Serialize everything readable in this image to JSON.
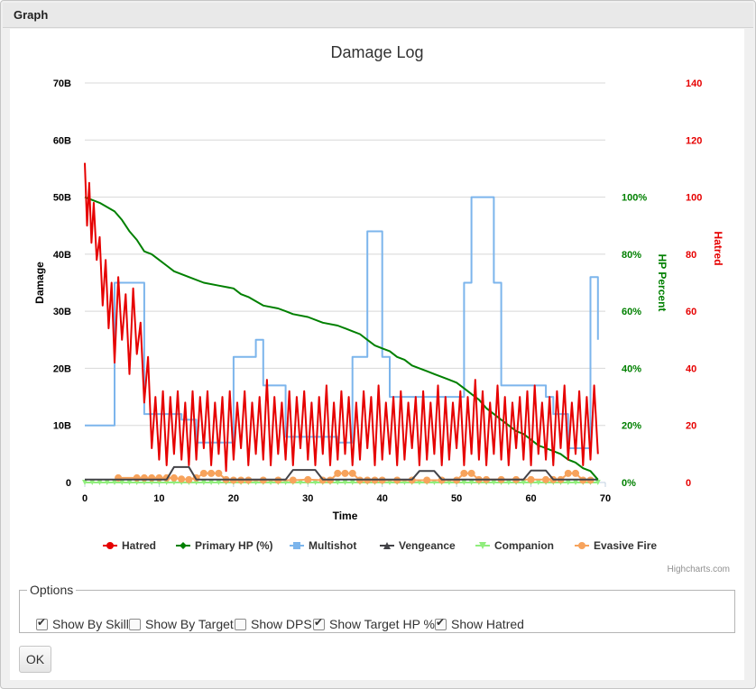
{
  "dialog": {
    "title": "Graph"
  },
  "options": {
    "legend": "Options",
    "items": [
      {
        "label": "Show By Skill",
        "checked": true
      },
      {
        "label": "Show By Target",
        "checked": false
      },
      {
        "label": "Show DPS",
        "checked": false
      },
      {
        "label": "Show Target HP %",
        "checked": true
      },
      {
        "label": "Show Hatred",
        "checked": true
      }
    ]
  },
  "ok_label": "OK",
  "credits": "Highcharts.com",
  "chart_data": {
    "type": "line",
    "title": "Damage Log",
    "xlabel": "Time",
    "xlim": [
      0,
      70
    ],
    "xticks": [
      "0",
      "10",
      "20",
      "30",
      "40",
      "50",
      "60",
      "70"
    ],
    "axes": {
      "damage": {
        "label": "Damage",
        "ylim": [
          0,
          70
        ],
        "ticks": [
          "0",
          "10B",
          "20B",
          "30B",
          "40B",
          "50B",
          "60B",
          "70B"
        ]
      },
      "hp": {
        "label": "HP Percent",
        "ylim": [
          0,
          140
        ],
        "ticks": [
          "0%",
          "20%",
          "40%",
          "60%",
          "80%",
          "100%"
        ],
        "color": "#008000"
      },
      "hatred": {
        "label": "Hatred",
        "ylim": [
          0,
          140
        ],
        "ticks": [
          "0",
          "20",
          "40",
          "60",
          "80",
          "100",
          "120",
          "140"
        ],
        "color": "#e60000"
      }
    },
    "grid": true,
    "legend_position": "bottom",
    "series": [
      {
        "name": "Hatred",
        "color": "#e60000",
        "axis": "hatred",
        "marker": "circle",
        "x": [
          0,
          0.3,
          0.6,
          0.9,
          1.2,
          1.6,
          2,
          2.4,
          2.8,
          3.2,
          3.6,
          4,
          4.5,
          5,
          5.5,
          6,
          6.5,
          7,
          7.5,
          8,
          8.5,
          9,
          9.5,
          10,
          10.5,
          11,
          11.5,
          12,
          12.5,
          13,
          13.5,
          14,
          14.5,
          15,
          15.5,
          16,
          16.5,
          17,
          17.5,
          18,
          18.5,
          19,
          19.5,
          20,
          20.5,
          21,
          21.5,
          22,
          22.5,
          23,
          23.5,
          24,
          24.5,
          25,
          25.5,
          26,
          26.5,
          27,
          27.5,
          28,
          28.5,
          29,
          29.5,
          30,
          30.5,
          31,
          31.5,
          32,
          32.5,
          33,
          33.5,
          34,
          34.5,
          35,
          35.5,
          36,
          36.5,
          37,
          37.5,
          38,
          38.5,
          39,
          39.5,
          40,
          40.5,
          41,
          41.5,
          42,
          42.5,
          43,
          43.5,
          44,
          44.5,
          45,
          45.5,
          46,
          46.5,
          47,
          47.5,
          48,
          48.5,
          49,
          49.5,
          50,
          50.5,
          51,
          51.5,
          52,
          52.5,
          53,
          53.5,
          54,
          54.5,
          55,
          55.5,
          56,
          56.5,
          57,
          57.5,
          58,
          58.5,
          59,
          59.5,
          60,
          60.5,
          61,
          61.5,
          62,
          62.5,
          63,
          63.5,
          64,
          64.5,
          65,
          65.5,
          66,
          66.5,
          67,
          67.5,
          68,
          68.5,
          69
        ],
        "y": [
          112,
          90,
          105,
          84,
          98,
          78,
          86,
          62,
          78,
          54,
          70,
          42,
          72,
          50,
          66,
          38,
          68,
          45,
          56,
          28,
          44,
          12,
          30,
          8,
          32,
          6,
          30,
          10,
          32,
          8,
          28,
          6,
          32,
          8,
          30,
          12,
          32,
          6,
          28,
          10,
          30,
          4,
          32,
          8,
          28,
          12,
          32,
          6,
          28,
          10,
          30,
          8,
          36,
          6,
          30,
          10,
          28,
          8,
          32,
          6,
          30,
          12,
          32,
          8,
          28,
          6,
          30,
          10,
          34,
          6,
          28,
          8,
          32,
          10,
          30,
          6,
          28,
          8,
          32,
          12,
          30,
          6,
          34,
          8,
          28,
          10,
          30,
          6,
          32,
          8,
          28,
          12,
          30,
          6,
          32,
          8,
          28,
          10,
          34,
          6,
          30,
          8,
          28,
          12,
          32,
          6,
          30,
          10,
          36,
          8,
          32,
          6,
          28,
          10,
          34,
          8,
          30,
          6,
          28,
          12,
          30,
          8,
          32,
          6,
          34,
          10,
          28,
          8,
          30,
          6,
          32,
          12,
          34,
          8,
          28,
          10,
          32,
          6,
          30,
          8,
          34,
          10
        ]
      },
      {
        "name": "Primary HP (%)",
        "color": "#008000",
        "axis": "hp",
        "marker": "diamond",
        "x": [
          0,
          2,
          4,
          5,
          6,
          7,
          8,
          9,
          10,
          11,
          12,
          14,
          16,
          18,
          20,
          21,
          22,
          24,
          26,
          27,
          28,
          30,
          32,
          34,
          35,
          36,
          37,
          38,
          39,
          40,
          41,
          42,
          43,
          44,
          45,
          46,
          47,
          48,
          49,
          50,
          51,
          52,
          53,
          54,
          55,
          56,
          57,
          58,
          59,
          60,
          61,
          62,
          63,
          64,
          65,
          66,
          67,
          68,
          69
        ],
        "y": [
          100,
          98,
          95,
          92,
          88,
          85,
          81,
          80,
          78,
          76,
          74,
          72,
          70,
          69,
          68,
          66,
          65,
          62,
          61,
          60,
          59,
          58,
          56,
          55,
          54,
          53,
          52,
          50,
          48,
          47,
          46,
          44,
          43,
          41,
          40,
          39,
          38,
          37,
          36,
          35,
          33,
          31,
          29,
          26,
          24,
          22,
          20,
          18,
          17,
          15,
          13,
          12,
          11,
          10,
          8,
          7,
          5,
          4,
          1
        ]
      },
      {
        "name": "Multishot",
        "color": "#7cb5ec",
        "axis": "damage",
        "marker": "square",
        "x": [
          0,
          4,
          4,
          8,
          8,
          13,
          13,
          15,
          15,
          20,
          20,
          23,
          23,
          24,
          24,
          27,
          27,
          34,
          34,
          36,
          36,
          38,
          38,
          40,
          40,
          41,
          41,
          51,
          51,
          52,
          52,
          55,
          55,
          56,
          56,
          62,
          62,
          63,
          63,
          65,
          65,
          68,
          68,
          69,
          69
        ],
        "y": [
          10,
          10,
          35,
          35,
          12,
          12,
          11,
          11,
          7,
          7,
          22,
          22,
          25,
          25,
          17,
          17,
          8,
          8,
          7,
          7,
          22,
          22,
          44,
          44,
          22,
          22,
          15,
          15,
          35,
          35,
          50,
          50,
          35,
          35,
          17,
          17,
          15,
          15,
          12,
          12,
          6,
          6,
          36,
          36,
          25
        ]
      },
      {
        "name": "Vengeance",
        "color": "#434348",
        "axis": "damage",
        "marker": "triangle",
        "x": [
          0,
          11,
          12,
          14,
          15,
          20,
          27,
          28,
          31,
          32,
          44,
          45,
          47,
          48,
          59,
          60,
          62,
          63,
          69
        ],
        "y": [
          0.5,
          0.5,
          2.7,
          2.7,
          0.5,
          0.5,
          0.5,
          2.2,
          2.2,
          0.5,
          0.5,
          2,
          2,
          0.5,
          0.5,
          2.1,
          2.1,
          0.5,
          0.5
        ]
      },
      {
        "name": "Companion",
        "color": "#90ed7d",
        "axis": "damage",
        "marker": "triangle-down",
        "x": [
          0,
          1,
          2,
          3,
          4,
          5,
          6,
          7,
          8,
          9,
          10,
          11,
          12,
          13,
          14,
          15,
          16,
          17,
          18,
          19,
          20,
          21,
          22,
          23,
          24,
          25,
          26,
          27,
          28,
          29,
          30,
          31,
          32,
          33,
          34,
          35,
          36,
          37,
          38,
          39,
          40,
          41,
          42,
          43,
          44,
          45,
          46,
          47,
          48,
          49,
          50,
          51,
          52,
          53,
          54,
          55,
          56,
          57,
          58,
          59,
          60,
          61,
          62,
          63,
          64,
          65,
          66,
          67,
          68,
          69
        ],
        "y": [
          0,
          0,
          0,
          0,
          0,
          0,
          0,
          0,
          0,
          0,
          0,
          0,
          0,
          0,
          0,
          0,
          0,
          0,
          0,
          0,
          0,
          0,
          0,
          0,
          0,
          0,
          0,
          0,
          0,
          0,
          0,
          0,
          0,
          0,
          0,
          0,
          0,
          0,
          0,
          0,
          0,
          0,
          0,
          0,
          0,
          0,
          0,
          0,
          0,
          0,
          0,
          0,
          0,
          0,
          0,
          0,
          0,
          0,
          0,
          0,
          0,
          0,
          0,
          0,
          0,
          0,
          0,
          0,
          0,
          0
        ]
      },
      {
        "name": "Evasive Fire",
        "color": "#f7a35c",
        "axis": "damage",
        "marker": "circle",
        "x": [
          4.5,
          7,
          8,
          9,
          10,
          11,
          12,
          13,
          14,
          15,
          16,
          17,
          18,
          19,
          20,
          21,
          22,
          24,
          26,
          28,
          30,
          32,
          33,
          34,
          35,
          36,
          37,
          38,
          39,
          40,
          42,
          44,
          46,
          48,
          50,
          51,
          52,
          53,
          54,
          56,
          58,
          60,
          62,
          63,
          64,
          65,
          66,
          67,
          68
        ],
        "y": [
          0.8,
          0.8,
          0.8,
          0.8,
          0.8,
          0.8,
          0.8,
          0.6,
          0.5,
          0.8,
          1.6,
          1.6,
          1.6,
          0.5,
          0.4,
          0.4,
          0.4,
          0.4,
          0.4,
          0.4,
          0.5,
          0.4,
          0.4,
          1.6,
          1.6,
          1.6,
          0.4,
          0.4,
          0.4,
          0.4,
          0.4,
          0.4,
          0.4,
          0.4,
          0.4,
          1.6,
          1.6,
          0.5,
          0.5,
          0.5,
          0.5,
          0.5,
          0.5,
          0.5,
          0.5,
          1.6,
          1.6,
          0.4,
          0.4
        ]
      }
    ]
  }
}
